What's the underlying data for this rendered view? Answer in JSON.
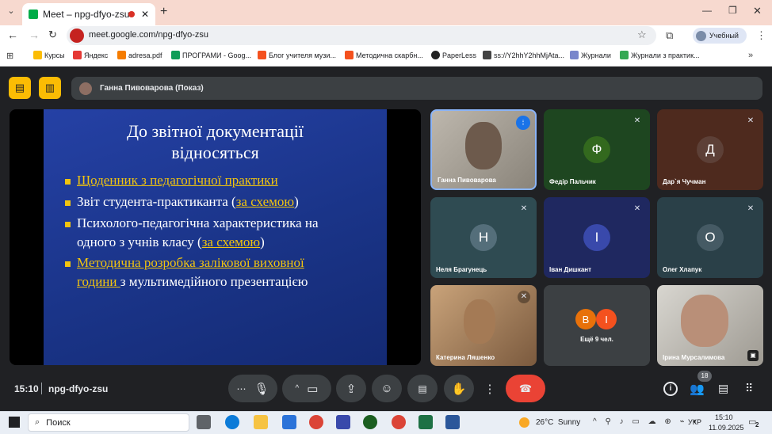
{
  "browser": {
    "tab_title": "Meet – npg-dfyo-zsu",
    "url": "meet.google.com/npg-dfyo-zsu",
    "profile_label": "Учебный",
    "bookmarks": [
      "Курсы",
      "Яндекс",
      "adresa.pdf",
      "ПРОГРАМИ - Goog...",
      "Блог учителя музи...",
      "Методична скарбн...",
      "PaperLess",
      "ss://Y2hhY2hhMjAta...",
      "Журнали",
      "Журнали з практик..."
    ]
  },
  "meet": {
    "presenter_banner": "Ганна Пивоварова (Показ)",
    "slide": {
      "title_line1": "До звітної документації",
      "title_line2": "відносяться",
      "b1_link": "Щоденник з педагогічної практики",
      "b2_text": "Звіт студента-практиканта (",
      "b2_link": "за схемою",
      "b2_end": ")",
      "b3_line1": "Психолого-педагогічна характеристика на",
      "b3_line2": "одного з учнів класу (",
      "b3_link": "за схемою",
      "b3_end": ")",
      "b4_link1": "Методична розробка залікової виховної",
      "b4_link2": "години ",
      "b4_end": "з мультимедійного презентацією"
    },
    "participants": [
      {
        "name": "Ганна Пивоварова"
      },
      {
        "name": "Федір Пальчик",
        "initial": "Ф",
        "color": "#33691e"
      },
      {
        "name": "Дар`я Чучман",
        "initial": "Д",
        "color": "#5d4037"
      },
      {
        "name": "Неля Брагунець",
        "initial": "Н",
        "color": "#546e7a"
      },
      {
        "name": "Іван Дишкант",
        "initial": "І",
        "color": "#3949ab"
      },
      {
        "name": "Олег Хлапук",
        "initial": "О",
        "color": "#455a64"
      },
      {
        "name": "Катерина Ляшенко"
      },
      {
        "name": "Ірина Мурсалимова"
      }
    ],
    "more_tile": {
      "initials": [
        "В",
        "І"
      ],
      "label": "Ещё 9 чел."
    },
    "time": "15:10",
    "meeting_code": "npg-dfyo-zsu",
    "people_count": "18"
  },
  "taskbar": {
    "search": "Поиск",
    "weather": "26°C  Sunny",
    "lang": "УКР",
    "clock_time": "15:10",
    "clock_date": "11.09.2025",
    "notif": "2"
  },
  "colors": {
    "accent": "#fbbc04",
    "end_call": "#ea4335",
    "slide_bg": "#1e3a8a"
  }
}
